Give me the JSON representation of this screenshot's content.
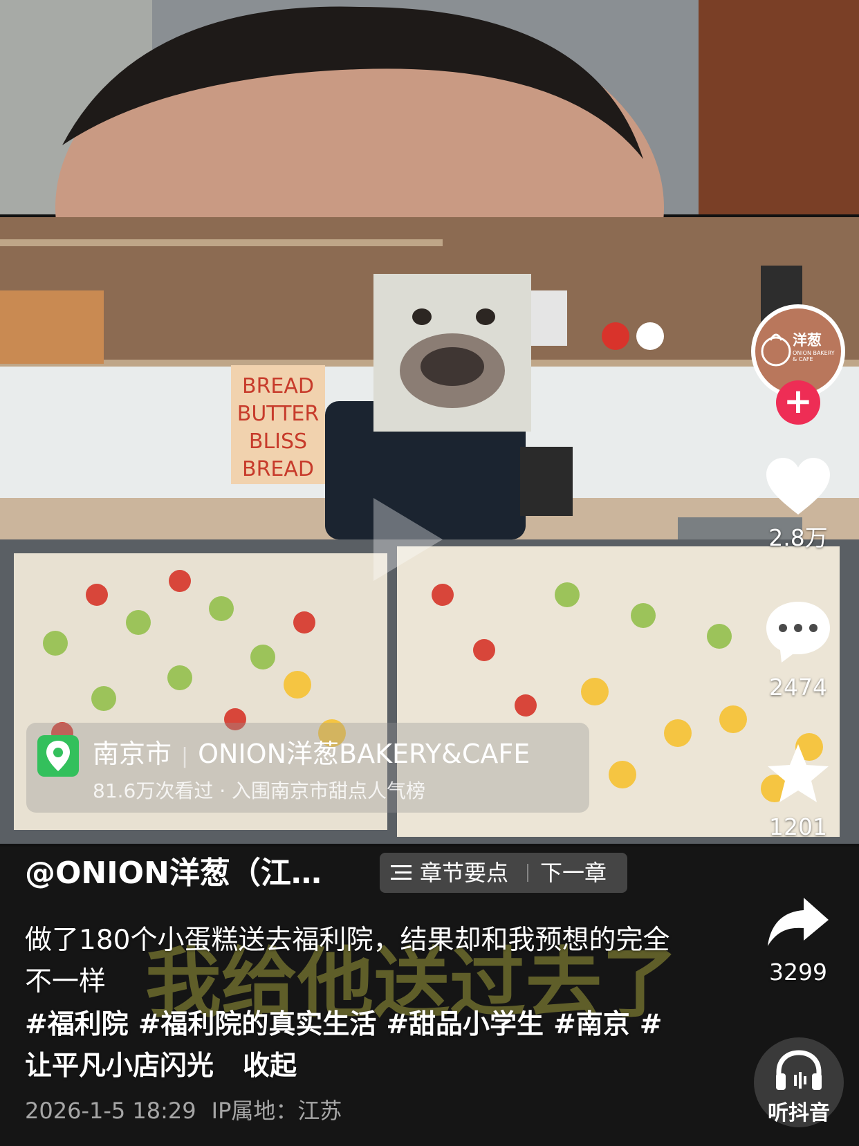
{
  "author": {
    "handle": "@ONION洋葱（江…",
    "avatar_text_zh": "洋葱",
    "avatar_text_en": "ONION BAKERY & CAFE"
  },
  "chapters": {
    "label": "章节要点",
    "next": "下一章"
  },
  "location": {
    "city": "南京市",
    "shop": "ONION洋葱BAKERY&CAFE",
    "views": "81.6万次看过 · 入围南京市甜点人气榜"
  },
  "actions": {
    "likes": "2.8万",
    "comments": "2474",
    "favorites": "1201",
    "shares": "3299",
    "listen": "听抖音"
  },
  "description": {
    "text": "做了180个小蛋糕送去福利院，结果却和我预想的完全不一样",
    "hashtags": [
      "#福利院",
      "#福利院的真实生活",
      "#甜品小学生",
      "#南京",
      "#让平凡小店闪光"
    ],
    "collapse": "收起"
  },
  "meta": {
    "datetime": "2026-1-5 18:29",
    "ip": "IP属地：江苏"
  },
  "colors": {
    "follow_red": "#ee2d55",
    "location_green": "#33c05c",
    "avatar_brown": "#b9775c"
  }
}
